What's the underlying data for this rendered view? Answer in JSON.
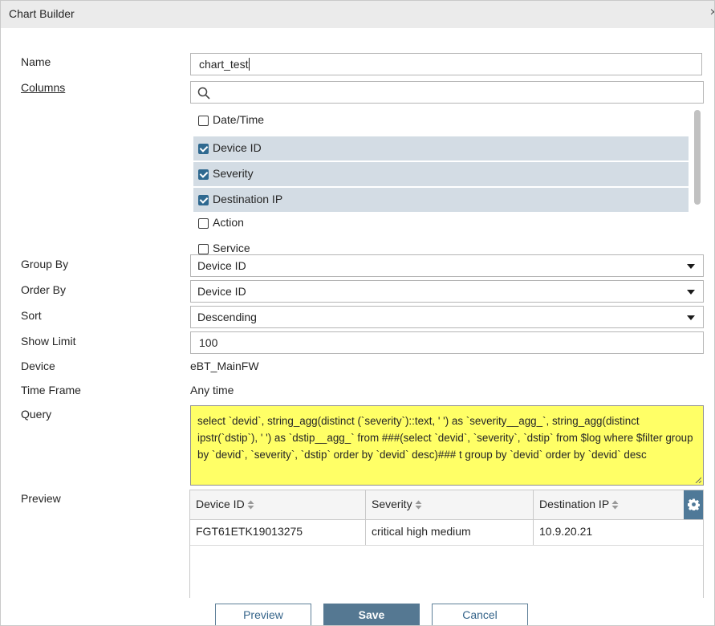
{
  "dialog": {
    "title": "Chart Builder",
    "close_label": "×"
  },
  "form": {
    "name": {
      "label": "Name",
      "value": "chart_test"
    },
    "columns": {
      "label": "Columns",
      "search_placeholder": "",
      "items": [
        {
          "label": "Date/Time",
          "checked": false
        },
        {
          "label": "Device ID",
          "checked": true
        },
        {
          "label": "Severity",
          "checked": true
        },
        {
          "label": "Destination IP",
          "checked": true
        },
        {
          "label": "Action",
          "checked": false
        },
        {
          "label": "Service",
          "checked": false
        }
      ]
    },
    "group_by": {
      "label": "Group By",
      "value": "Device ID"
    },
    "order_by": {
      "label": "Order By",
      "value": "Device ID"
    },
    "sort": {
      "label": "Sort",
      "value": "Descending"
    },
    "show_limit": {
      "label": "Show Limit",
      "value": "100"
    },
    "device": {
      "label": "Device",
      "value": "eBT_MainFW"
    },
    "time_frame": {
      "label": "Time Frame",
      "value": "Any time"
    },
    "query": {
      "label": "Query",
      "value": "select `devid`, string_agg(distinct (`severity`)::text, ' ') as `severity__agg_`, string_agg(distinct ipstr(`dstip`), ' ') as `dstip__agg_` from ###(select `devid`, `severity`, `dstip` from $log where $filter group by `devid`, `severity`, `dstip` order by `devid` desc)### t group by `devid` order by `devid` desc",
      "highlight_color": "#ffff66"
    }
  },
  "preview": {
    "label": "Preview",
    "columns": [
      "Device ID",
      "Severity",
      "Destination IP"
    ],
    "rows": [
      [
        "FGT61ETK19013275",
        "critical high medium",
        "10.9.20.21"
      ]
    ]
  },
  "buttons": {
    "preview": "Preview",
    "save": "Save",
    "cancel": "Cancel"
  },
  "colors": {
    "accent": "#557892",
    "selected_row": "#d3dce4",
    "checkbox": "#2f6990"
  }
}
